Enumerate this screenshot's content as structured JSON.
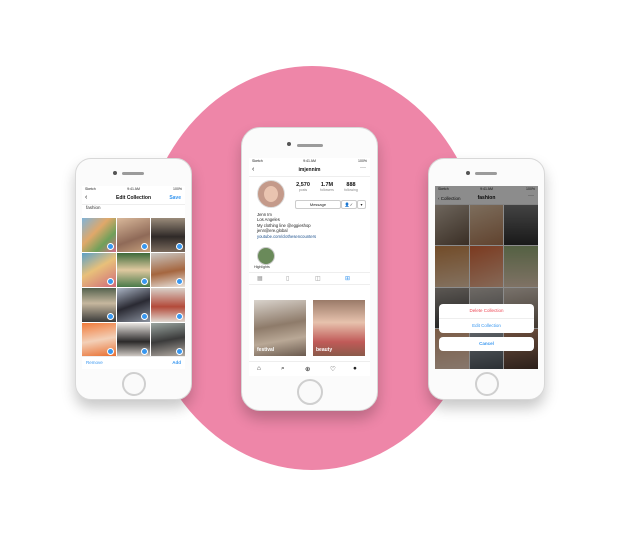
{
  "left": {
    "status": {
      "carrier": "Sketch",
      "time": "9:41 AM",
      "battery": "100%"
    },
    "title": "Edit Collection",
    "save_label": "Save",
    "caption": "fashion",
    "remove_label": "Remove",
    "add_label": "Add"
  },
  "center": {
    "status": {
      "carrier": "Sketch",
      "time": "9:41 AM",
      "battery": "100%"
    },
    "username": "imjennim",
    "stats": [
      {
        "value": "2,570",
        "label": "posts"
      },
      {
        "value": "1.7M",
        "label": "followers"
      },
      {
        "value": "888",
        "label": "following"
      }
    ],
    "message_label": "Message",
    "bio": {
      "name": "Jenn Im",
      "location": "Los Angeles",
      "line": "My clothing line @eggieshop",
      "email": "jenn@ere.global",
      "link": "youtube.com/clothesencounters"
    },
    "highlight_label": "Highlights",
    "posts": [
      {
        "label": "festival"
      },
      {
        "label": "beauty"
      }
    ]
  },
  "right": {
    "status": {
      "carrier": "Sketch",
      "time": "9:41 AM",
      "battery": "100%"
    },
    "back_label": "Collection",
    "title": "fashion",
    "actions": {
      "delete": "Delete Collection",
      "edit": "Edit Collection"
    },
    "cancel_label": "Cancel"
  },
  "colors": {
    "accent": "#3897f0",
    "danger": "#ed4956",
    "circle": "#ee86a8"
  }
}
